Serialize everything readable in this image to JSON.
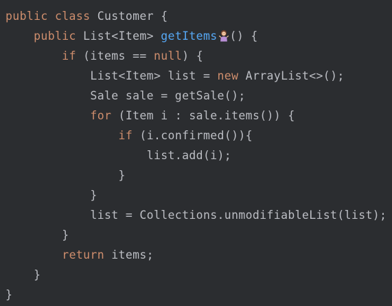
{
  "colors": {
    "background": "#2b2d30",
    "text": "#bcbec4",
    "keyword": "#cf8e6d",
    "method_declaration": "#56a8f5"
  },
  "emoji_icon": "person-shrugging-emoji",
  "lines": [
    {
      "indent": "",
      "segments": [
        {
          "t": "public class",
          "c": "kw"
        },
        {
          "t": " Customer {",
          "c": ""
        }
      ]
    },
    {
      "indent": "    ",
      "segments": [
        {
          "t": "public",
          "c": "kw"
        },
        {
          "t": " List<Item> ",
          "c": ""
        },
        {
          "t": "getItems",
          "c": "fn"
        },
        {
          "t": "EMOJI",
          "c": "emoji"
        },
        {
          "t": "() {",
          "c": ""
        }
      ]
    },
    {
      "indent": "        ",
      "segments": [
        {
          "t": "if",
          "c": "kw"
        },
        {
          "t": " (items == ",
          "c": ""
        },
        {
          "t": "null",
          "c": "kw"
        },
        {
          "t": ") {",
          "c": ""
        }
      ]
    },
    {
      "indent": "            ",
      "segments": [
        {
          "t": "List<Item> list = ",
          "c": ""
        },
        {
          "t": "new",
          "c": "kw"
        },
        {
          "t": " ArrayList<>();",
          "c": ""
        }
      ]
    },
    {
      "indent": "            ",
      "segments": [
        {
          "t": "Sale sale = getSale();",
          "c": ""
        }
      ]
    },
    {
      "indent": "            ",
      "segments": [
        {
          "t": "for",
          "c": "kw"
        },
        {
          "t": " (Item i : sale.items()) {",
          "c": ""
        }
      ]
    },
    {
      "indent": "                ",
      "segments": [
        {
          "t": "if",
          "c": "kw"
        },
        {
          "t": " (i.confirmed()){",
          "c": ""
        }
      ]
    },
    {
      "indent": "                    ",
      "segments": [
        {
          "t": "list.add(i);",
          "c": ""
        }
      ]
    },
    {
      "indent": "                ",
      "segments": [
        {
          "t": "}",
          "c": ""
        }
      ]
    },
    {
      "indent": "            ",
      "segments": [
        {
          "t": "}",
          "c": ""
        }
      ]
    },
    {
      "indent": "            ",
      "segments": [
        {
          "t": "list = Collections.unmodifiableList(list);",
          "c": ""
        }
      ]
    },
    {
      "indent": "        ",
      "segments": [
        {
          "t": "}",
          "c": ""
        }
      ]
    },
    {
      "indent": "        ",
      "segments": [
        {
          "t": "return",
          "c": "kw"
        },
        {
          "t": " items;",
          "c": ""
        }
      ]
    },
    {
      "indent": "    ",
      "segments": [
        {
          "t": "}",
          "c": ""
        }
      ]
    },
    {
      "indent": "",
      "segments": [
        {
          "t": "}",
          "c": ""
        }
      ]
    }
  ]
}
